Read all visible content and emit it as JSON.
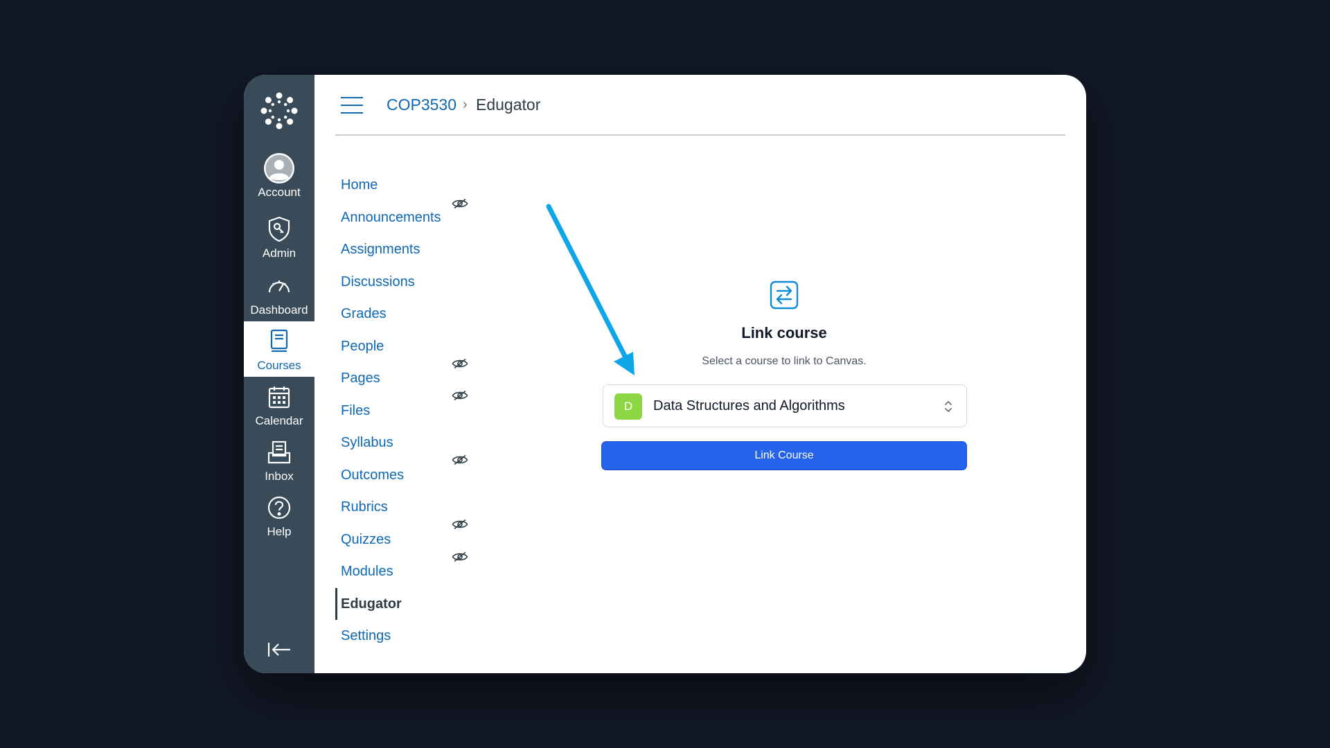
{
  "global_nav": {
    "items": [
      {
        "label": "Account",
        "icon": "user-avatar-icon"
      },
      {
        "label": "Admin",
        "icon": "shield-key-icon"
      },
      {
        "label": "Dashboard",
        "icon": "speedometer-icon"
      },
      {
        "label": "Courses",
        "icon": "book-icon"
      },
      {
        "label": "Calendar",
        "icon": "calendar-icon"
      },
      {
        "label": "Inbox",
        "icon": "inbox-icon"
      },
      {
        "label": "Help",
        "icon": "help-icon"
      }
    ],
    "active": "Courses",
    "background": "#394b58"
  },
  "breadcrumb": {
    "course": "COP3530",
    "separator": "›",
    "current": "Edugator"
  },
  "course_nav": {
    "items": [
      {
        "label": "Home",
        "hidden": false
      },
      {
        "label": "Announcements",
        "hidden": true
      },
      {
        "label": "Assignments",
        "hidden": false
      },
      {
        "label": "Discussions",
        "hidden": false
      },
      {
        "label": "Grades",
        "hidden": false
      },
      {
        "label": "People",
        "hidden": false
      },
      {
        "label": "Pages",
        "hidden": true
      },
      {
        "label": "Files",
        "hidden": true
      },
      {
        "label": "Syllabus",
        "hidden": false
      },
      {
        "label": "Outcomes",
        "hidden": true
      },
      {
        "label": "Rubrics",
        "hidden": false
      },
      {
        "label": "Quizzes",
        "hidden": true
      },
      {
        "label": "Modules",
        "hidden": true
      },
      {
        "label": "Edugator",
        "hidden": false
      },
      {
        "label": "Settings",
        "hidden": false
      }
    ],
    "active": "Edugator",
    "link_color": "#0e68b3"
  },
  "link_panel": {
    "title": "Link course",
    "subtitle": "Select a course to link to Canvas.",
    "selected_course": {
      "initial": "D",
      "name": "Data Structures and Algorithms",
      "badge_color": "#8cd743"
    },
    "button_label": "Link Course",
    "button_color": "#2563eb"
  },
  "annotation": {
    "arrow_color": "#0ea5e9"
  }
}
